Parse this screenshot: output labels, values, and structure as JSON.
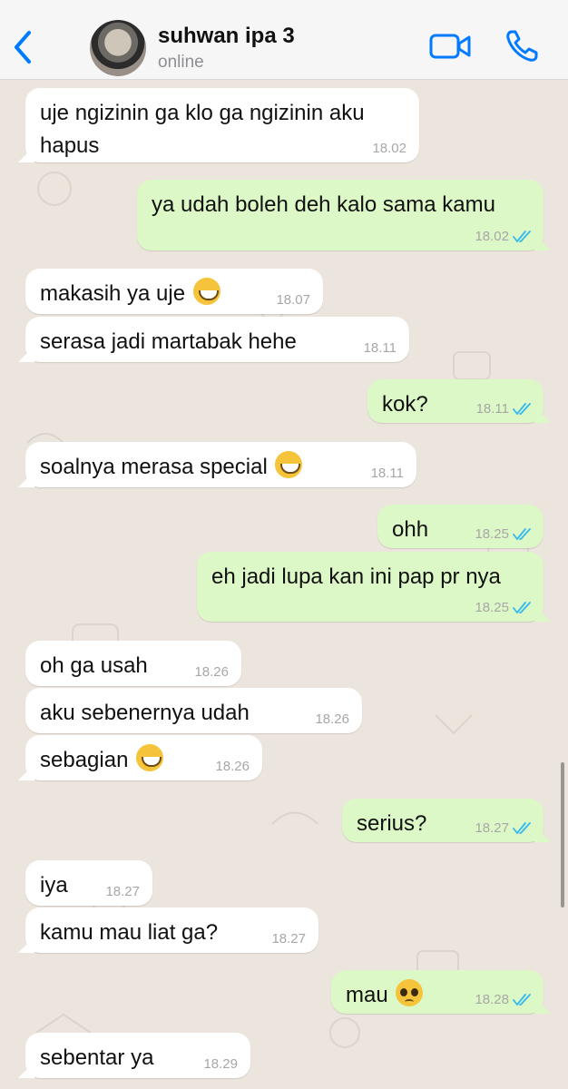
{
  "header": {
    "contact_name": "suhwan ipa 3",
    "status": "online",
    "accent_color": "#007AFF"
  },
  "messages": [
    {
      "dir": "in",
      "text": "uje ngizinin ga klo ga ngizinin aku hapus",
      "time": "18.02"
    },
    {
      "dir": "out",
      "text": "ya udah boleh deh kalo sama kamu",
      "time": "18.02",
      "read": true
    },
    {
      "dir": "in",
      "text": "makasih ya uje",
      "emoji": "grinning-face-icon",
      "time": "18.07"
    },
    {
      "dir": "in",
      "text": "serasa jadi martabak hehe",
      "time": "18.11"
    },
    {
      "dir": "out",
      "text": "kok?",
      "time": "18.11",
      "read": true
    },
    {
      "dir": "in",
      "text": "soalnya merasa special",
      "emoji": "grinning-face-icon",
      "time": "18.11"
    },
    {
      "dir": "out",
      "text": "ohh",
      "time": "18.25",
      "read": true
    },
    {
      "dir": "out",
      "text": "eh jadi lupa kan ini pap pr nya",
      "time": "18.25",
      "read": true
    },
    {
      "dir": "in",
      "text": "oh ga usah",
      "time": "18.26"
    },
    {
      "dir": "in",
      "text": "aku sebenernya udah",
      "time": "18.26"
    },
    {
      "dir": "in",
      "text": "sebagian",
      "emoji": "grinning-face-icon",
      "time": "18.26"
    },
    {
      "dir": "out",
      "text": "serius?",
      "time": "18.27",
      "read": true
    },
    {
      "dir": "in",
      "text": "iya",
      "time": "18.27"
    },
    {
      "dir": "in",
      "text": "kamu mau liat ga?",
      "time": "18.27"
    },
    {
      "dir": "out",
      "text": "mau",
      "emoji": "pleading-face-icon",
      "time": "18.28",
      "read": true
    },
    {
      "dir": "in",
      "text": "sebentar ya",
      "time": "18.29"
    }
  ]
}
